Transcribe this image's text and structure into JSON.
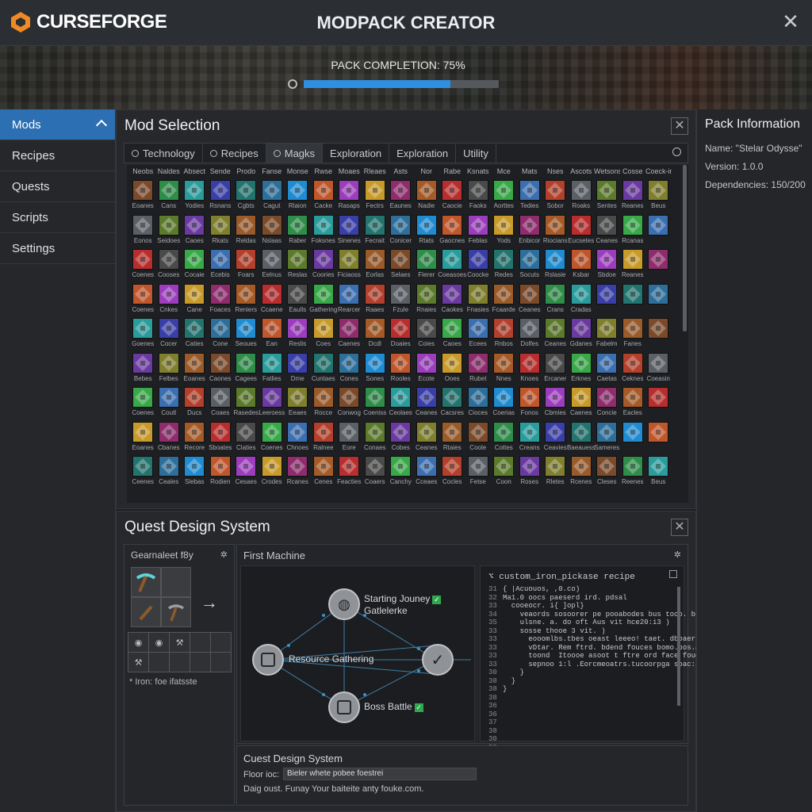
{
  "header": {
    "brand": "CURSEFORGE",
    "title": "MODPACK CREATOR"
  },
  "completion": {
    "label": "PACK COMPLETION: 75%",
    "fraction": 0.75
  },
  "sidebar": {
    "items": [
      {
        "label": "Mods",
        "active": true
      },
      {
        "label": "Recipes",
        "active": false
      },
      {
        "label": "Quests",
        "active": false
      },
      {
        "label": "Scripts",
        "active": false
      },
      {
        "label": "Settings",
        "active": false
      }
    ]
  },
  "mod_selection": {
    "title": "Mod Selection",
    "tabs": [
      {
        "label": "Technology",
        "icon": "search-icon"
      },
      {
        "label": "Recipes",
        "icon": "search-icon"
      },
      {
        "label": "Magks",
        "icon": "search-icon"
      },
      {
        "label": "Exploration",
        "icon": ""
      },
      {
        "label": "Exploration",
        "icon": ""
      },
      {
        "label": "Utility",
        "icon": ""
      }
    ],
    "columns": [
      "Neobs",
      "Naldes",
      "Absect",
      "Sende",
      "Prodo",
      "Fanse",
      "Monse",
      "Rwse",
      "Moaes",
      "Rleaes",
      "Asts",
      "Nor",
      "Rabe",
      "Ksnats",
      "Mce",
      "Mats",
      "Nses",
      "Ascots",
      "Wetsons",
      "Cosse",
      "Coeck-inbu"
    ],
    "row_labels": [
      [
        "Eoanes",
        "Cans",
        "Yodies",
        "Rsnans",
        "Cgbts",
        "Cagut",
        "Rlaion",
        "Cacke",
        "Rasaps",
        "Fectrs",
        "Eaunes",
        "Nadie",
        "Caocie",
        "Faoks",
        "Aorttes",
        "Tedies",
        "Sobor",
        "Roaks",
        "Sentes",
        "Reanes",
        "Beus",
        "Rs"
      ],
      [
        "Eonos",
        "Seidoes",
        "Caoes",
        "Rkats",
        "Reldas",
        "Nslaas",
        "Raber",
        "Foksnes",
        "Sinenes",
        "Fecrait",
        "Conicer",
        "Rtats",
        "Gaocnes",
        "Feblas",
        "Yods",
        "Enbicor",
        "Riocians",
        "Eucsetes",
        "Ceanes",
        "Rcanas"
      ],
      [
        "Coenes",
        "Cooses",
        "Cocaie",
        "Ecebis",
        "Foars",
        "Eelnus",
        "Reslas",
        "Coories",
        "Ficiaoss",
        "Eorlas",
        "Selaes",
        "Flerer",
        "Coeasoes",
        "Coocke",
        "Redes",
        "Socuts",
        "Rslasie",
        "Ksbar",
        "Sbdoe",
        "Reanes"
      ],
      [
        "Coenes",
        "Cnkes",
        "Cane",
        "Foaces",
        "Reniers",
        "Ccaene",
        "Eaulls",
        "Gathering",
        "Rearcer",
        "Raaes",
        "Fzule",
        "Rnaies",
        "Caokes",
        "Fnasies",
        "Fcaarde",
        "Ceanes",
        "Crans",
        "Cradas"
      ],
      [
        "Goenes",
        "Cocer",
        "Caties",
        "Cone",
        "Seoues",
        "Ean",
        "Reslis",
        "Coes",
        "Caenes",
        "Dcdl",
        "Doaies",
        "Coies",
        "Caoes",
        "Ecees",
        "Rnbos",
        "Dolfes",
        "Ceanes",
        "Gdanes",
        "Fabelm",
        "Fanes"
      ],
      [
        "Bebes",
        "Felbes",
        "Eoanes",
        "Caones",
        "Cagees",
        "Fatlies",
        "Dme",
        "Cuntaes",
        "Cones",
        "Sones",
        "Rooles",
        "Ecote",
        "Ooes",
        "Rubet",
        "Nnes",
        "Knoes",
        "Ercaner",
        "Erknes",
        "Caetas",
        "Ceknes",
        "Coeasin",
        "Reales"
      ],
      [
        "Coenes",
        "Coutl",
        "Ducs",
        "Coaes",
        "Rasedes",
        "Leeroess",
        "Eeaes",
        "Rocce",
        "Conwog",
        "Coeniss",
        "Ceolaes",
        "Ceanes",
        "Cacsres",
        "Cioces",
        "Coerias",
        "Fonos",
        "Cbmies",
        "Caenes",
        "Concie",
        "Eacles"
      ],
      [
        "Eoanes",
        "Cbanes",
        "Recore",
        "Sboates",
        "Claties",
        "Coenes",
        "Chnoes",
        "Ralnee",
        "Eore",
        "Conaes",
        "Cobes",
        "Ceanes",
        "Rtaies",
        "Coole",
        "Cottes",
        "Creans",
        "Ceavies",
        "Baeauess",
        "Sameres"
      ],
      [
        "Ceenes",
        "Ceales",
        "Slebas",
        "Rodien",
        "Cesaes",
        "Crodes",
        "Rcanes",
        "Cenes",
        "Feacties",
        "Coaers",
        "Canchy",
        "Cceaes",
        "Cocles",
        "Fetse",
        "Coon",
        "Roses",
        "Rletes",
        "Rcenes",
        "Cleses",
        "Reenes",
        "Beus",
        "Fa"
      ]
    ],
    "tile_colors": [
      "#7a4a2a",
      "#3c6fb0",
      "#9b3dbd",
      "#2f8d4a",
      "#b3402c",
      "#c79a2a",
      "#2a9c9c",
      "#5b5f66",
      "#8e2c6c",
      "#3a3fa8",
      "#5c7a2c",
      "#a55a28",
      "#23746e",
      "#6a3aa0",
      "#b82e2e",
      "#2d6f9a",
      "#7f7f2e",
      "#4a4a4a",
      "#1f8bd0",
      "#9a5b2b",
      "#38a848",
      "#c0562b"
    ]
  },
  "quests": {
    "title": "Quest Design System",
    "recipe_panel": {
      "title": "Gearnaleet f8y",
      "note": "* Iron: foe ifatsste"
    },
    "flow": {
      "title": "First Machine",
      "nodes": [
        {
          "label": "Starting Jouney",
          "sublabel": "Gatlelerke",
          "done": true
        },
        {
          "label": "Resource Gathering",
          "sublabel": "",
          "done": false
        },
        {
          "label": "",
          "sublabel": "",
          "done": true
        },
        {
          "label": "Boss Battle",
          "sublabel": "",
          "done": true
        }
      ]
    },
    "script": {
      "title": "custom_iron_pickase recipe",
      "line_numbers": [
        "31",
        "32",
        "33",
        "34",
        "35",
        "33",
        "33",
        "33",
        "33",
        "33",
        "30",
        "38",
        "38",
        "38",
        "36",
        "36",
        "37",
        "38",
        "30",
        "30",
        "31",
        "35",
        "38",
        "38",
        "33"
      ],
      "lines": [
        "{ |Acuouos, ,0.co)",
        "Ma1.0 oocs paeserd ird. pdsal",
        "  cooeocr. i{ ]opl}",
        "    veaords sosoorer pe pooabodes bus tooo. bseesi]",
        "    ulsne. a. do oft Aus vit hce20:i3 )",
        "    sosse thooe 3 vit. )",
        "      eooomlbs.tbes oeast leeeo! taet. dboaert)",
        "      vDtar. Rem ftrd. bdend fouces bomo.bos.a.l, Ealrb",
        "      toond  Itoooe asoot t ftre ord face foudanctuiks",
        "      sepnoo 1:l .Eorcmeoatrs.tucoorpga soac:i}",
        "    }",
        "  }",
        "}"
      ]
    },
    "info": {
      "title": "Cuest Design System",
      "field_label": "Floor  ioc:",
      "field_value": "Bieler whete pobee foestrei",
      "desc": "Daig oust.  Funay Your baiteite anty fouke.com."
    }
  },
  "pack_info": {
    "title": "Pack Information",
    "name": "Name: \"Stelar Odysse\"",
    "version": "Version: 1.0.0",
    "dependencies": "Dependencies: 150/200"
  },
  "colors": {
    "accent": "#2d6fb3",
    "progress": "#2f8fe0",
    "check": "#2fa84f",
    "brand_orange": "#f08a24"
  }
}
